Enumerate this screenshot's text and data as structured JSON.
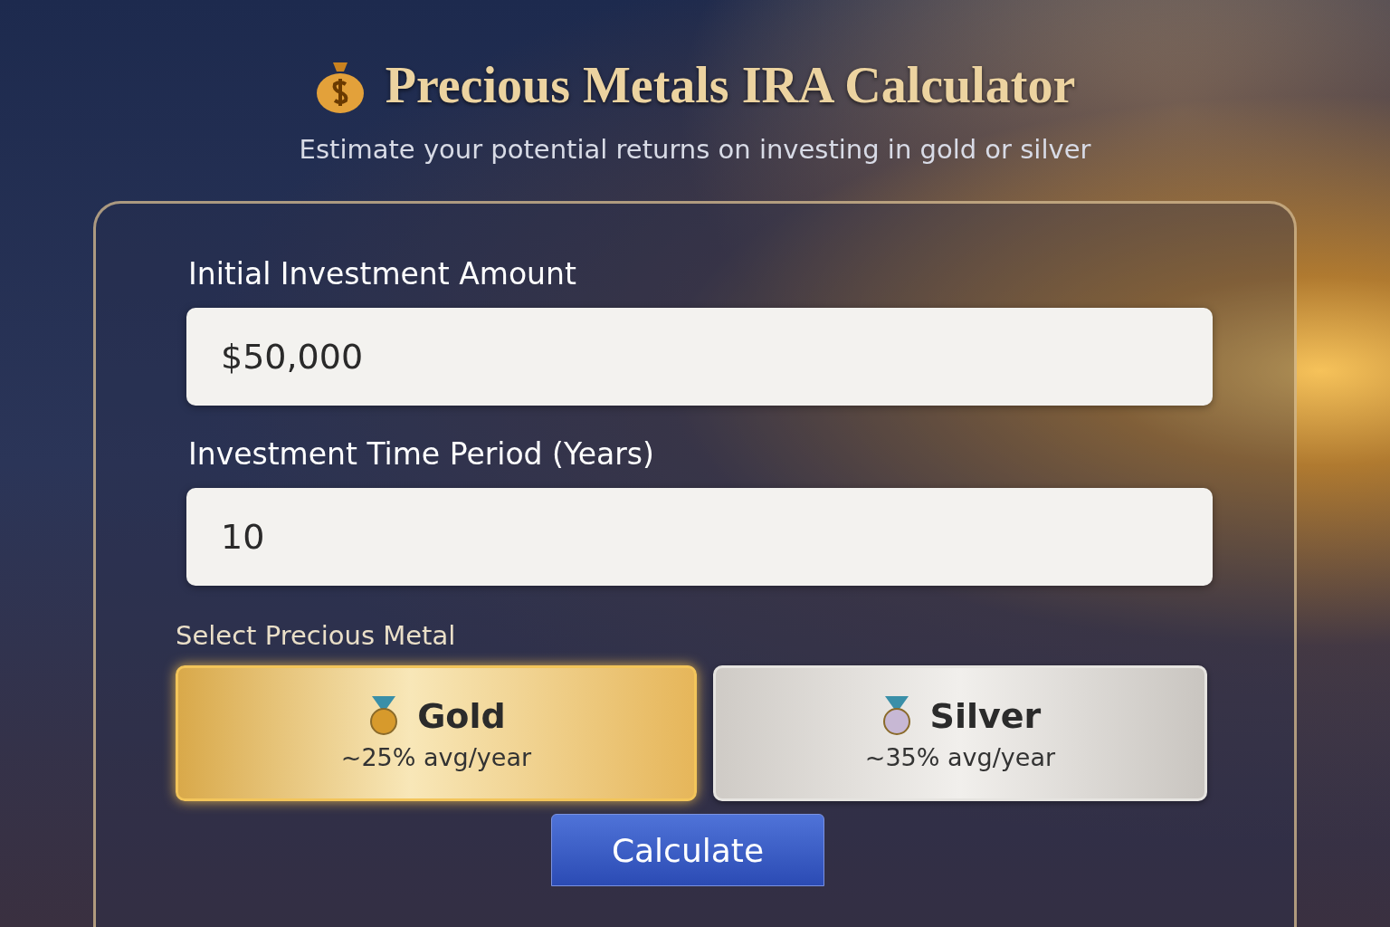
{
  "header": {
    "title": "Precious Metals IRA Calculator",
    "subtitle": "Estimate your potential returns on investing in gold or silver"
  },
  "form": {
    "fields": [
      {
        "label": "Initial Investment Amount",
        "value": "$50,000"
      },
      {
        "label": "Investment Time Period (Years)",
        "value": "10"
      }
    ],
    "metal_select": {
      "label": "Select Precious Metal",
      "options": [
        {
          "kind": "gold",
          "name": "Gold",
          "rate": "~25% avg/year",
          "selected": true
        },
        {
          "kind": "silver",
          "name": "Silver",
          "rate": "~35% avg/year",
          "selected": false
        }
      ]
    },
    "button": "Calculate"
  }
}
